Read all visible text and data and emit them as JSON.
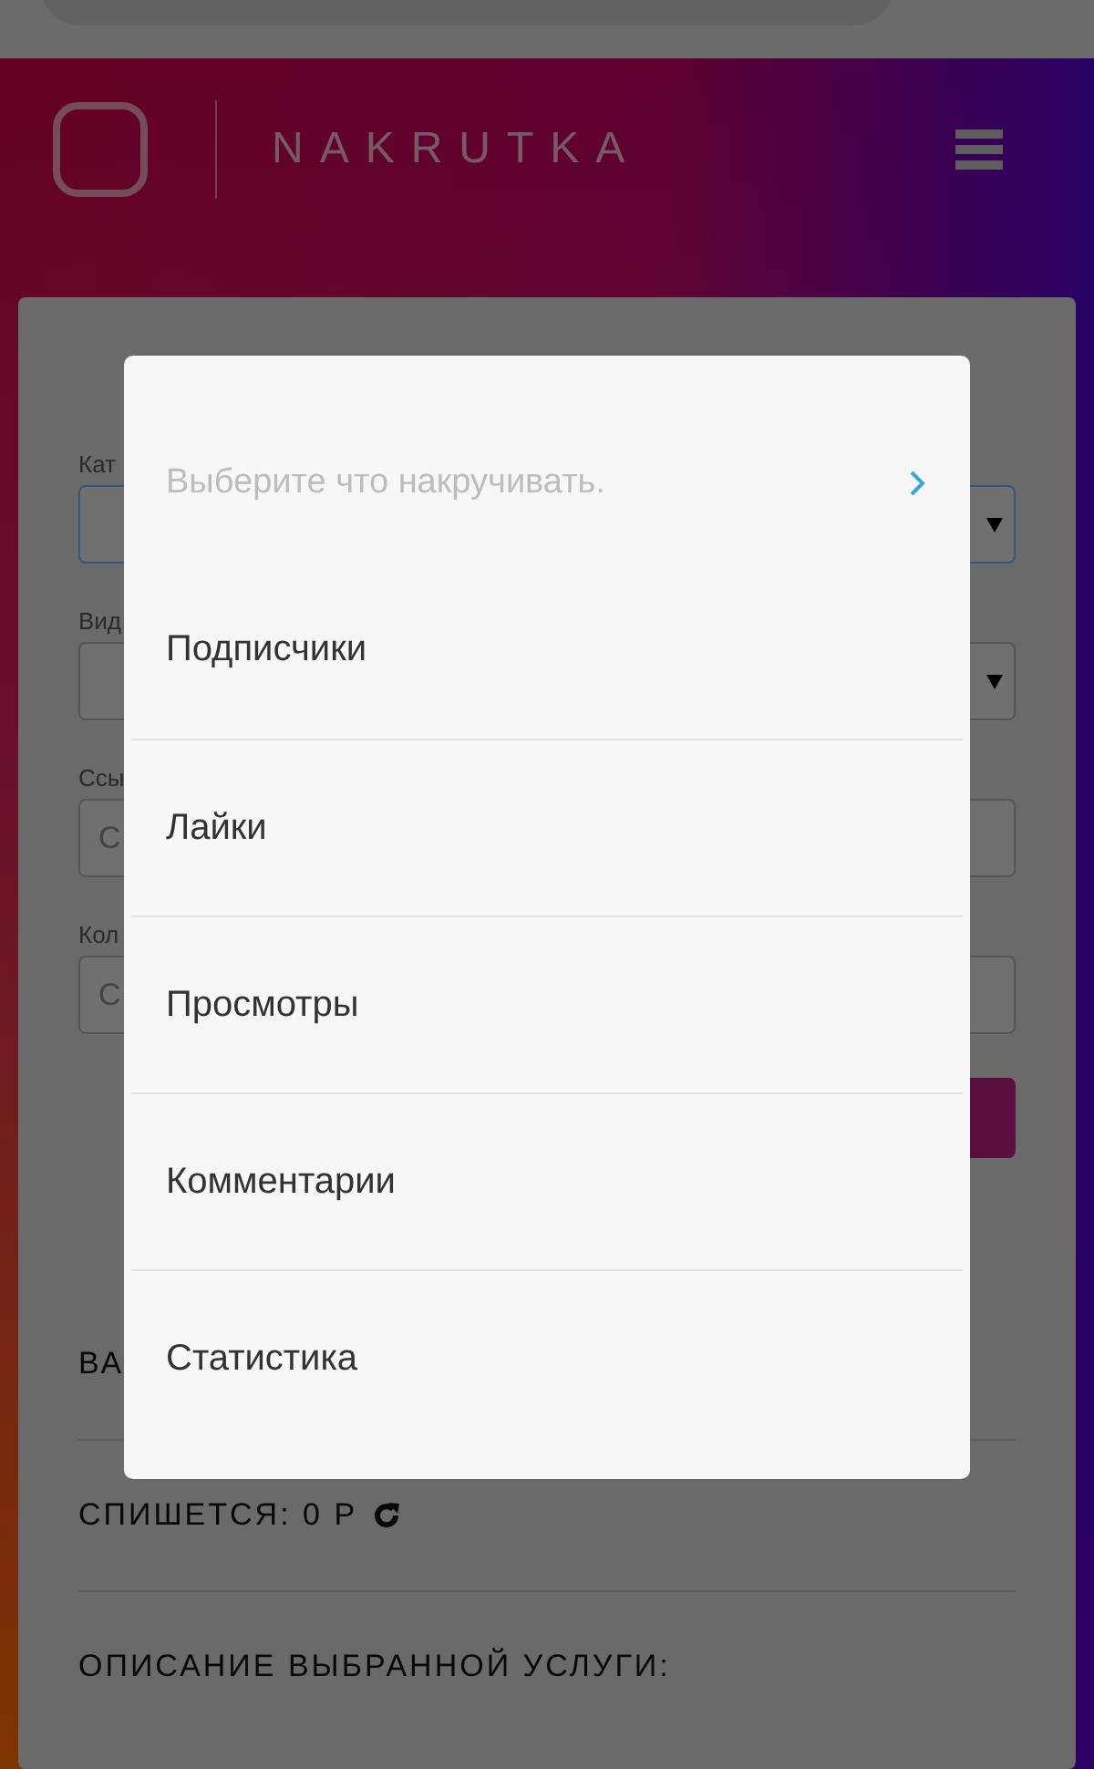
{
  "header": {
    "brand": "NAKRUTKA"
  },
  "form": {
    "fields": [
      {
        "kind": "select",
        "label": "Кат",
        "focused": true
      },
      {
        "kind": "select",
        "label": "Вид",
        "focused": false
      },
      {
        "kind": "input",
        "label": "Ссы",
        "placeholder": "С",
        "focused": false
      },
      {
        "kind": "input",
        "label": "Кол",
        "placeholder": "С",
        "focused": false
      }
    ]
  },
  "info_rows": [
    {
      "kind": "text",
      "text": "ВА"
    },
    {
      "kind": "refresh",
      "text": "СПИШЕТСЯ: 0 Р"
    },
    {
      "kind": "text",
      "text": "ОПИСАНИЕ ВЫБРАННОЙ УСЛУГИ:"
    }
  ],
  "dialog": {
    "title": "Выберите что накручивать.",
    "options": [
      "Подписчики",
      "Лайки",
      "Просмотры",
      "Комментарии",
      "Статистика"
    ]
  }
}
